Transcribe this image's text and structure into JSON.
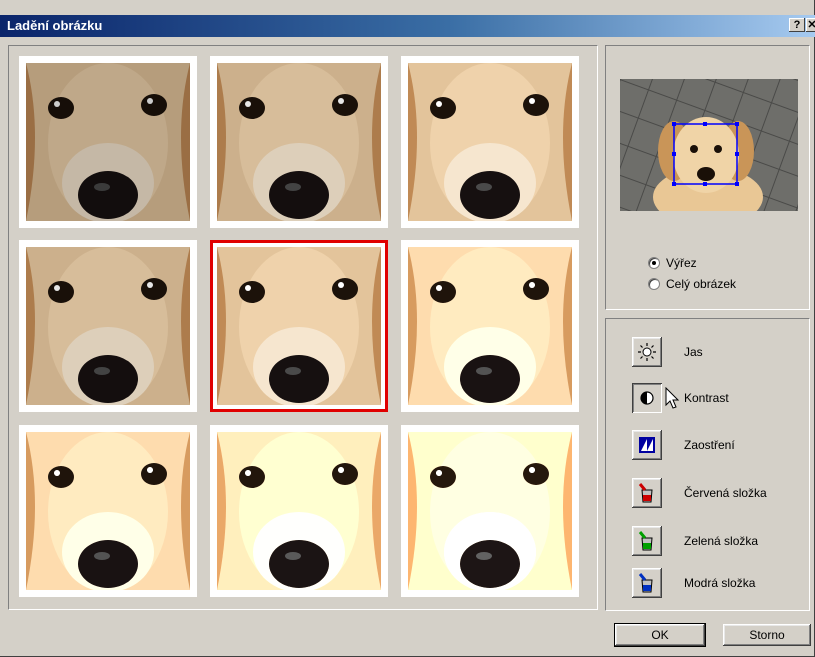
{
  "window": {
    "title": "Ladění obrázku",
    "help_label": "?",
    "close_label": "✕"
  },
  "variants": [
    {
      "brightness": 0.8,
      "selected": false
    },
    {
      "brightness": 0.9,
      "selected": false
    },
    {
      "brightness": 1.0,
      "selected": false
    },
    {
      "brightness": 0.9,
      "selected": false
    },
    {
      "brightness": 1.0,
      "selected": true
    },
    {
      "brightness": 1.12,
      "selected": false
    },
    {
      "brightness": 1.12,
      "selected": false
    },
    {
      "brightness": 1.22,
      "selected": false
    },
    {
      "brightness": 1.32,
      "selected": false
    }
  ],
  "preview": {
    "options": [
      {
        "label": "Výřez",
        "checked": true
      },
      {
        "label": "Celý obrázek",
        "checked": false
      }
    ]
  },
  "tools": [
    {
      "label": "Jas",
      "icon": "sun-icon",
      "pressed": false
    },
    {
      "label": "Kontrast",
      "icon": "contrast-icon",
      "pressed": true
    },
    {
      "label": "Zaostření",
      "icon": "sharpen-icon",
      "pressed": false
    },
    {
      "label": "Červená složka",
      "icon": "red-bucket-icon",
      "pressed": false
    },
    {
      "label": "Zelená složka",
      "icon": "green-bucket-icon",
      "pressed": false
    },
    {
      "label": "Modrá složka",
      "icon": "blue-bucket-icon",
      "pressed": false
    }
  ],
  "buttons": {
    "ok": "OK",
    "cancel": "Storno"
  },
  "colors": {
    "selection_border": "#e00000",
    "selection_box": "#0000ff"
  }
}
